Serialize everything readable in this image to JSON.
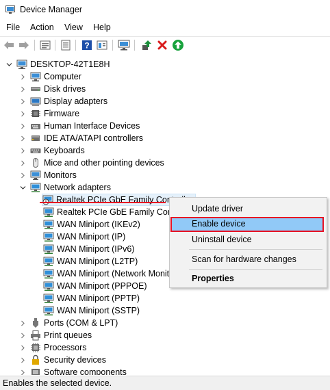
{
  "window": {
    "title": "Device Manager"
  },
  "menu": [
    "File",
    "Action",
    "View",
    "Help"
  ],
  "toolbar": {
    "icons": [
      "back-icon",
      "forward-icon",
      "properties-icon",
      "refresh-icon",
      "help-icon",
      "view-icon",
      "scan-hardware-icon",
      "update-driver-icon",
      "uninstall-icon",
      "enable-device-icon"
    ],
    "colors": {
      "update": "#1a8f3a",
      "uninstall": "#d91a1a",
      "enable": "#17a23c",
      "help": "#1e4fa8"
    }
  },
  "tree": {
    "root": "DESKTOP-42T1E8H",
    "categories": [
      "Computer",
      "Disk drives",
      "Display adapters",
      "Firmware",
      "Human Interface Devices",
      "IDE ATA/ATAPI controllers",
      "Keyboards",
      "Mice and other pointing devices",
      "Monitors",
      "Network adapters"
    ],
    "network_adapters": [
      "Realtek PCIe GbE Family Controller",
      "Realtek PCIe GbE Family Controller",
      "WAN Miniport (IKEv2)",
      "WAN Miniport (IP)",
      "WAN Miniport (IPv6)",
      "WAN Miniport (L2TP)",
      "WAN Miniport (Network Monitor)",
      "WAN Miniport (PPPOE)",
      "WAN Miniport (PPTP)",
      "WAN Miniport (SSTP)"
    ],
    "after_categories": [
      "Ports (COM & LPT)",
      "Print queues",
      "Processors",
      "Security devices",
      "Software components"
    ]
  },
  "context_menu": {
    "update_driver": "Update driver",
    "enable_device": "Enable device",
    "uninstall_device": "Uninstall device",
    "scan": "Scan for hardware changes",
    "properties": "Properties"
  },
  "status_bar": "Enables the selected device."
}
